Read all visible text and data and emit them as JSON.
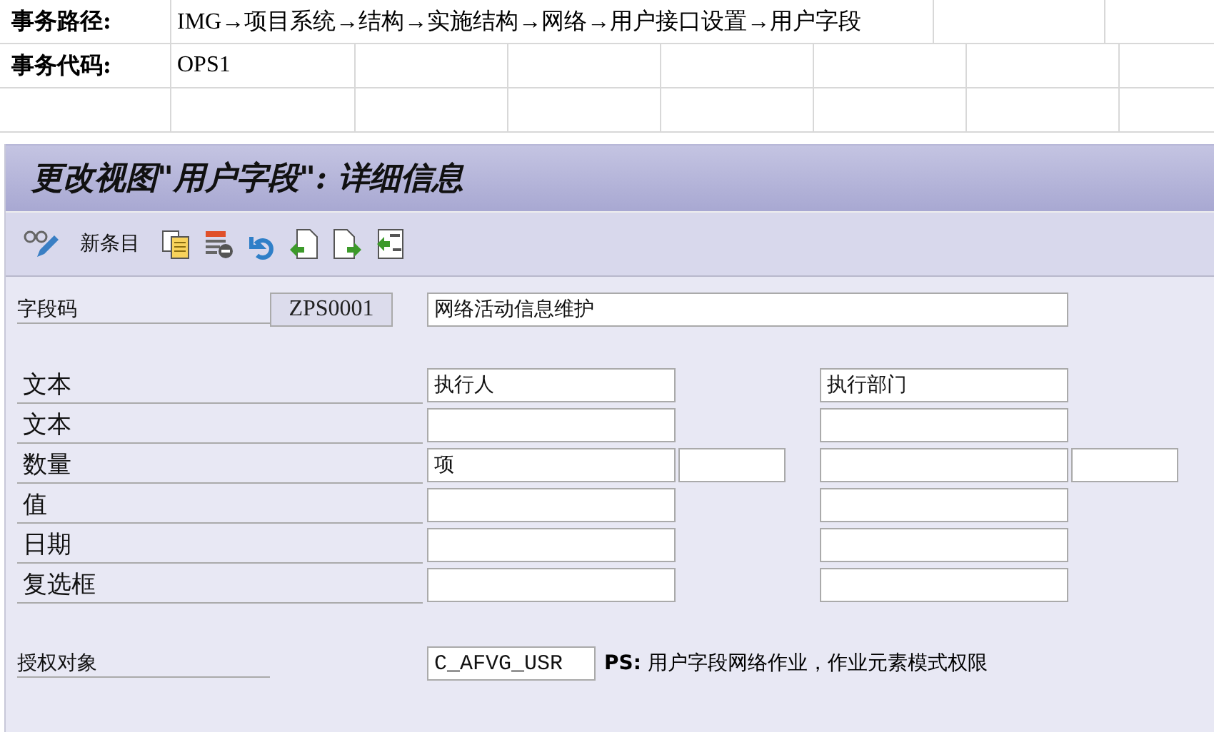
{
  "sheet": {
    "rows": [
      {
        "label": "事务路径:",
        "value": "IMG→项目系统→结构→实施结构→网络→用户接口设置→用户字段"
      },
      {
        "label": "事务代码:",
        "value": "OPS1"
      }
    ]
  },
  "window": {
    "title": "更改视图\"用户字段\": 详细信息"
  },
  "toolbar": {
    "new_entries": "新条目"
  },
  "field_code": {
    "label": "字段码",
    "code": "ZPS0001",
    "description": "网络活动信息维护"
  },
  "rows": [
    {
      "label": "文本",
      "left": "执行人",
      "right": "执行部门",
      "extra_fields": false
    },
    {
      "label": "文本",
      "extra_fields": false
    },
    {
      "label": "数量",
      "left": "项",
      "extra_fields": true
    },
    {
      "label": "值",
      "extra_fields": false
    },
    {
      "label": "日期",
      "extra_fields": false
    },
    {
      "label": "复选框",
      "extra_fields": false
    }
  ],
  "authorization": {
    "label": "授权对象",
    "value": "C_AFVG_USR",
    "note": "**PS:** 用户字段网络作业，作业元素模式权限"
  }
}
